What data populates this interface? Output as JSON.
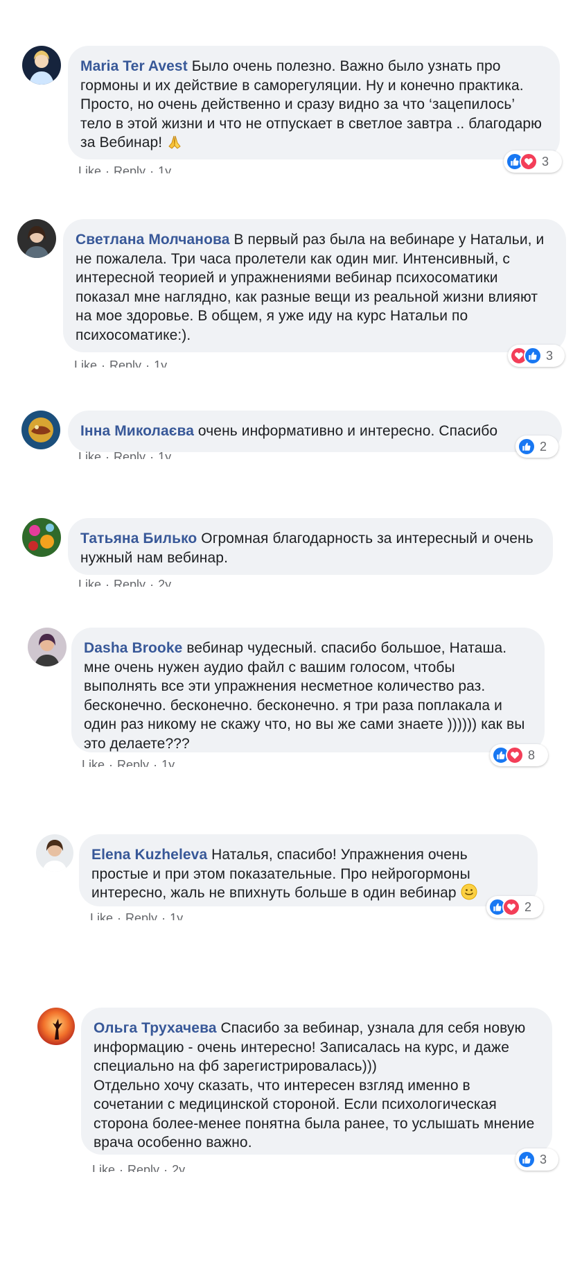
{
  "comments": [
    {
      "author": "Maria Ter Avest",
      "text": " Было очень полезно. Важно было узнать про гормоны и их действие в саморегуляции. Ну и конечно практика. Просто, но очень действенно и сразу видно за что ‘зацепилось’ тело в этой жизни и что не отпускает в светлое завтра .. благодарю за Вебинар! ",
      "emoji": "🙏",
      "actions": [
        "Like",
        "Reply",
        "1y"
      ],
      "reaction_count": "3"
    },
    {
      "author": "Светлана Молчанова",
      "text": " В первый раз была на вебинаре у Натальи, и не пожалела. Три часа пролетели как один миг. Интенсивный, с интересной теорией и упражнениями вебинар психосоматики показал мне наглядно, как разные вещи из реальной жизни влияют на мое здоровье. В общем, я уже иду на курс Натальи по психосоматике:).",
      "actions": [
        "Like",
        "Reply",
        "1y"
      ],
      "reaction_count": "3"
    },
    {
      "author": "Інна Миколаєва",
      "text": " очень информативно и интересно. Спасибо",
      "actions": [
        "Like",
        "Reply",
        "1y"
      ],
      "reaction_count": "2"
    },
    {
      "author": "Татьяна Билько",
      "text": " Огромная благодарность за интересный и очень нужный нам вебинар.",
      "actions": [
        "Like",
        "Reply",
        "2y"
      ]
    },
    {
      "author": "Dasha Brooke",
      "text": " вебинар чудесный. спасибо большое, Наташа. мне очень нужен аудио файл с вашим голосом, чтобы выполнять все эти упражнения несметное количество раз. бесконечно. бесконечно. бесконечно. я три раза поплакала и один раз никому не скажу что, но вы же сами знаете )))))) как вы это делаете???",
      "actions": [
        "Like",
        "Reply",
        "1y"
      ],
      "reaction_count": "8"
    },
    {
      "author": "Elena Kuzheleva",
      "text": " Наталья, спасибо! Упражнения очень простые и при этом показательные. Про нейрогормоны интересно, жаль не впихнуть больше в один вебинар ",
      "emoji": "🙂",
      "actions": [
        "Like",
        "Reply",
        "1y"
      ],
      "reaction_count": "2"
    },
    {
      "author": "Ольга Трухачева",
      "text": " Спасибо за вебинар, узнала для себя новую информацию - очень интересно! Записалась на курс, и даже специально на фб зарегистрировалась)))\nОтдельно хочу сказать, что интересен взгляд именно в сочетании с медицинской стороной. Если психологическая сторона более-менее понятна была ранее, то услышать мнение врача особенно важно.",
      "actions": [
        "Like",
        "Reply",
        "2y"
      ],
      "reaction_count": "3"
    }
  ],
  "colors": {
    "author": "#385898",
    "bubble": "#f0f2f5",
    "like": "#1877f2",
    "love": "#f33e58",
    "meta": "#65676b"
  }
}
